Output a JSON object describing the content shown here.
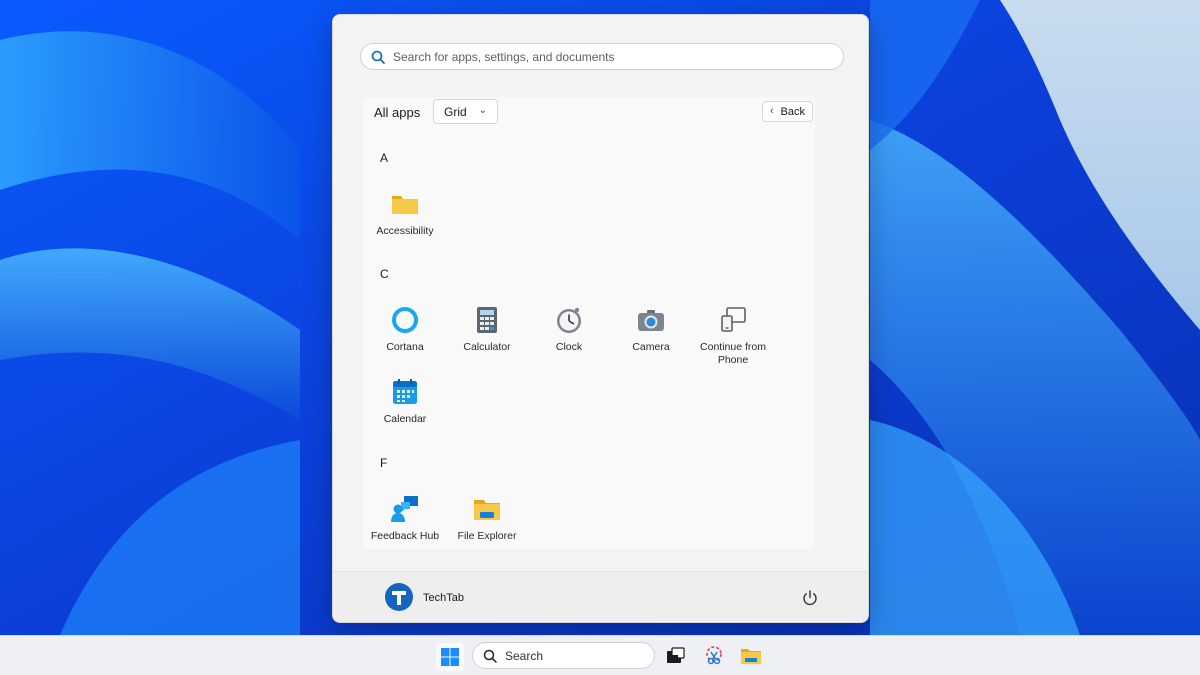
{
  "search": {
    "placeholder": "Search for apps, settings, and documents"
  },
  "header": {
    "title": "All apps",
    "view_label": "Grid",
    "back_label": "Back"
  },
  "sections": [
    {
      "letter": "A",
      "apps": [
        "Accessibility"
      ]
    },
    {
      "letter": "C",
      "apps": [
        "Cortana",
        "Calculator",
        "Clock",
        "Camera",
        "Continue from Phone",
        "Calendar"
      ]
    },
    {
      "letter": "F",
      "apps": [
        "Feedback Hub",
        "File Explorer"
      ]
    }
  ],
  "footer": {
    "user_name": "TechTab"
  },
  "taskbar": {
    "search_label": "Search"
  },
  "colors": {
    "accent": "#0078d4",
    "folder": "#f7c948",
    "avatar": "#1565c0"
  }
}
